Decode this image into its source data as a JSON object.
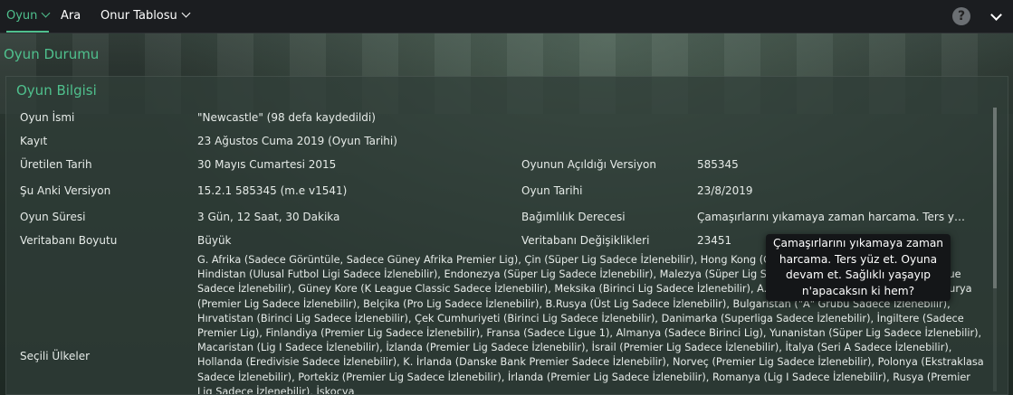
{
  "nav": {
    "items": [
      {
        "label": "Oyun",
        "active": true,
        "has_dropdown": true
      },
      {
        "label": "Ara",
        "active": false,
        "has_dropdown": false
      },
      {
        "label": "Onur Tablosu",
        "active": false,
        "has_dropdown": true
      }
    ],
    "help_icon": "question-icon",
    "menu_icon": "chevron-down-icon"
  },
  "page_title": "Oyun Durumu",
  "panel": {
    "title": "Oyun Bilgisi",
    "rows": [
      {
        "label": "Oyun İsmi",
        "value": "\"Newcastle\" (98 defa kaydedildi)"
      },
      {
        "label": "Kayıt",
        "value": "23 Ağustos Cuma 2019 (Oyun Tarihi)"
      },
      {
        "label": "Üretilen Tarih",
        "value": "30 Mayıs Cumartesi 2015",
        "label2": "Oyunun Açıldığı Versiyon",
        "value2": "585345"
      },
      {
        "label": "Şu Anki Versiyon",
        "value": "15.2.1 585345 (m.e v1541)",
        "label2": "Oyun Tarihi",
        "value2": "23/8/2019"
      },
      {
        "label": "Oyun Süresi",
        "value": "3 Gün, 12 Saat, 30 Dakika",
        "label2": "Bağımlılık Derecesi",
        "value2": "Çamaşırlarını yıkamaya zaman harcama. Ters yüz et. Oyuna devam et. Sağlıklı yaşayıp n'apacaksın ki hem?"
      },
      {
        "label": "Veritabanı Boyutu",
        "value": "Büyük",
        "label2": "Veritabanı Değişiklikleri",
        "value2": "23451"
      }
    ],
    "countries_label": "Seçili Ülkeler",
    "countries_text": "G. Afrika (Sadece Görüntüle, Sadece Güney Afrika Premier Lig), Çin (Süper Lig Sadece İzlenebilir), Hong Kong (Çin Premier Lig Sadece İzlenebilir), Hindistan (Ulusal Futbol Ligi Sadece İzlenebilir), Endonezya (Süper Lig Sadece İzlenebilir), Malezya (Süper Lig Sadece İzlenebilir), Singapur (S.League Sadece İzlenebilir), Güney Kore (K League Classic Sadece İzlenebilir), Meksika (Birinci Lig Sadece İzlenebilir), A.B.D. (MLS Sadece İzlenebilir), Avusturya (Premier Lig Sadece İzlenebilir), Belçika (Pro Lig Sadece İzlenebilir), B.Rusya (Üst Lig Sadece İzlenebilir), Bulgaristan (\"A\" Grubu Sadece İzlenebilir), Hırvatistan (Birinci Lig Sadece İzlenebilir), Çek Cumhuriyeti (Birinci Lig Sadece İzlenebilir), Danimarka (Superliga Sadece İzlenebilir), İngiltere (Sadece Premier Lig), Finlandiya (Premier Lig Sadece İzlenebilir), Fransa (Sadece Ligue 1), Almanya (Sadece Birinci Lig), Yunanistan (Süper Lig Sadece İzlenebilir), Macaristan (Lig I Sadece İzlenebilir), İzlanda (Premier Lig Sadece İzlenebilir), İsrail (Premier Lig Sadece İzlenebilir), İtalya (Seri A Sadece İzlenebilir), Hollanda (Eredivisie Sadece İzlenebilir), K. İrlanda (Danske Bank Premier Sadece İzlenebilir), Norveç (Premier Lig Sadece İzlenebilir), Polonya (Ekstraklasa Sadece İzlenebilir), Portekiz (Premier Lig Sadece İzlenebilir), İrlanda (Premier Lig Sadece İzlenebilir), Romanya (Lig I Sadece İzlenebilir), Rusya (Premier Lig Sadece İzlenebilir), İskoçya"
  },
  "tooltip": {
    "text": "Çamaşırlarını yıkamaya zaman harcama. Ters yüz et. Oyuna devam et. Sağlıklı yaşayıp n'apacaksın ki hem?"
  },
  "colors": {
    "accent": "#4fc08d",
    "topbar": "#1b1d20",
    "tooltip_bg": "#141618"
  }
}
